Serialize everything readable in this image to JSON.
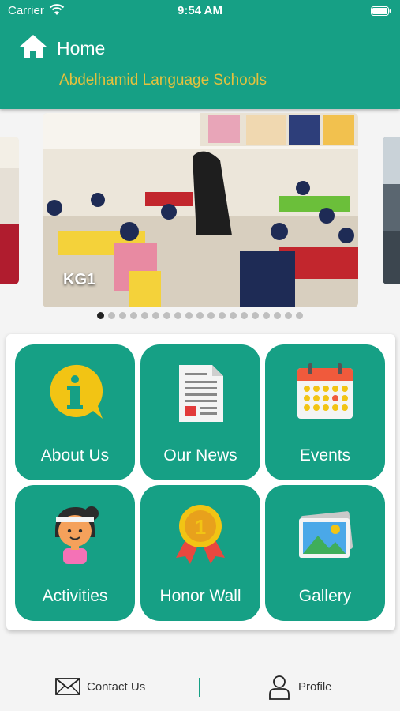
{
  "status": {
    "carrier": "Carrier",
    "time": "9:54 AM"
  },
  "header": {
    "title": "Home",
    "subtitle": "Abdelhamid Language Schools"
  },
  "carousel": {
    "caption": "KG1",
    "dot_count": 19,
    "active_index": 0
  },
  "tiles": [
    {
      "label": "About Us",
      "icon": "info-bubble-icon"
    },
    {
      "label": "Our News",
      "icon": "newspaper-icon"
    },
    {
      "label": "Events",
      "icon": "calendar-icon"
    },
    {
      "label": "Activities",
      "icon": "child-avatar-icon"
    },
    {
      "label": "Honor Wall",
      "icon": "medal-icon"
    },
    {
      "label": "Gallery",
      "icon": "photo-gallery-icon"
    }
  ],
  "bottom": {
    "contact": "Contact Us",
    "profile": "Profile"
  },
  "colors": {
    "primary": "#16a085",
    "accent": "#e5c13d"
  }
}
